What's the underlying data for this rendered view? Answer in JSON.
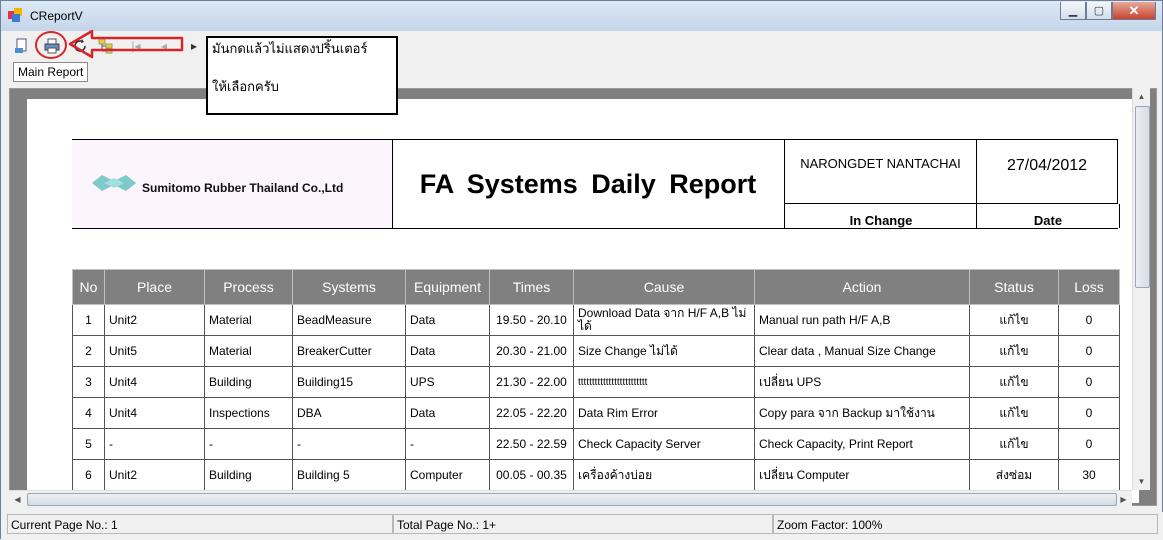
{
  "window": {
    "title": "CReportV"
  },
  "toolbar": {
    "tab_label": "Main Report"
  },
  "annotation": {
    "line1": "มันกดแล้วไม่แสดงปริ้นเตอร์",
    "line2": "ให้เลือกครับ"
  },
  "report": {
    "company": "Sumitomo Rubber Thailand Co.,Ltd",
    "title": "FA Systems Daily Report",
    "in_change_name": "NARONGDET NANTACHAI",
    "date_value": "27/04/2012",
    "in_change_label": "In Change",
    "date_label": "Date"
  },
  "table": {
    "headers": [
      "No",
      "Place",
      "Process",
      "Systems",
      "Equipment",
      "Times",
      "Cause",
      "Action",
      "Status",
      "Loss"
    ],
    "rows": [
      [
        "1",
        "Unit2",
        "Material",
        "BeadMeasure",
        "Data",
        "19.50 - 20.10",
        "Download Data จาก H/F A,B ไม่ได้",
        "Manual run path H/F A,B",
        "แก้ไข",
        "0"
      ],
      [
        "2",
        "Unit5",
        "Material",
        "BreakerCutter",
        "Data",
        "20.30 - 21.00",
        "Size Change ไม่ได้",
        "Clear data , Manual Size Change",
        "แก้ไข",
        "0"
      ],
      [
        "3",
        "Unit4",
        "Building",
        "Building15",
        "UPS",
        "21.30 - 22.00",
        "ttttttttttttttttttttttttt",
        "เปลี่ยน UPS",
        "แก้ไข",
        "0"
      ],
      [
        "4",
        "Unit4",
        "Inspections",
        "DBA",
        "Data",
        "22.05 - 22.20",
        "Data Rim Error",
        "Copy para จาก Backup มาใช้งาน",
        "แก้ไข",
        "0"
      ],
      [
        "5",
        "-",
        "-",
        "-",
        "-",
        "22.50 - 22.59",
        "Check Capacity Server",
        "Check Capacity, Print Report",
        "แก้ไข",
        "0"
      ],
      [
        "6",
        "Unit2",
        "Building",
        "Building 5",
        "Computer",
        "00.05 - 00.35",
        "เครื่องค้างบ่อย",
        "เปลี่ยน Computer",
        "ส่งซ่อม",
        "30"
      ]
    ]
  },
  "statusbar": {
    "current_page": "Current Page No.: 1",
    "total_page": "Total Page No.: 1+",
    "zoom": "Zoom Factor: 100%"
  },
  "colors": {
    "accent_red": "#d9242a",
    "table_header": "#808080"
  }
}
